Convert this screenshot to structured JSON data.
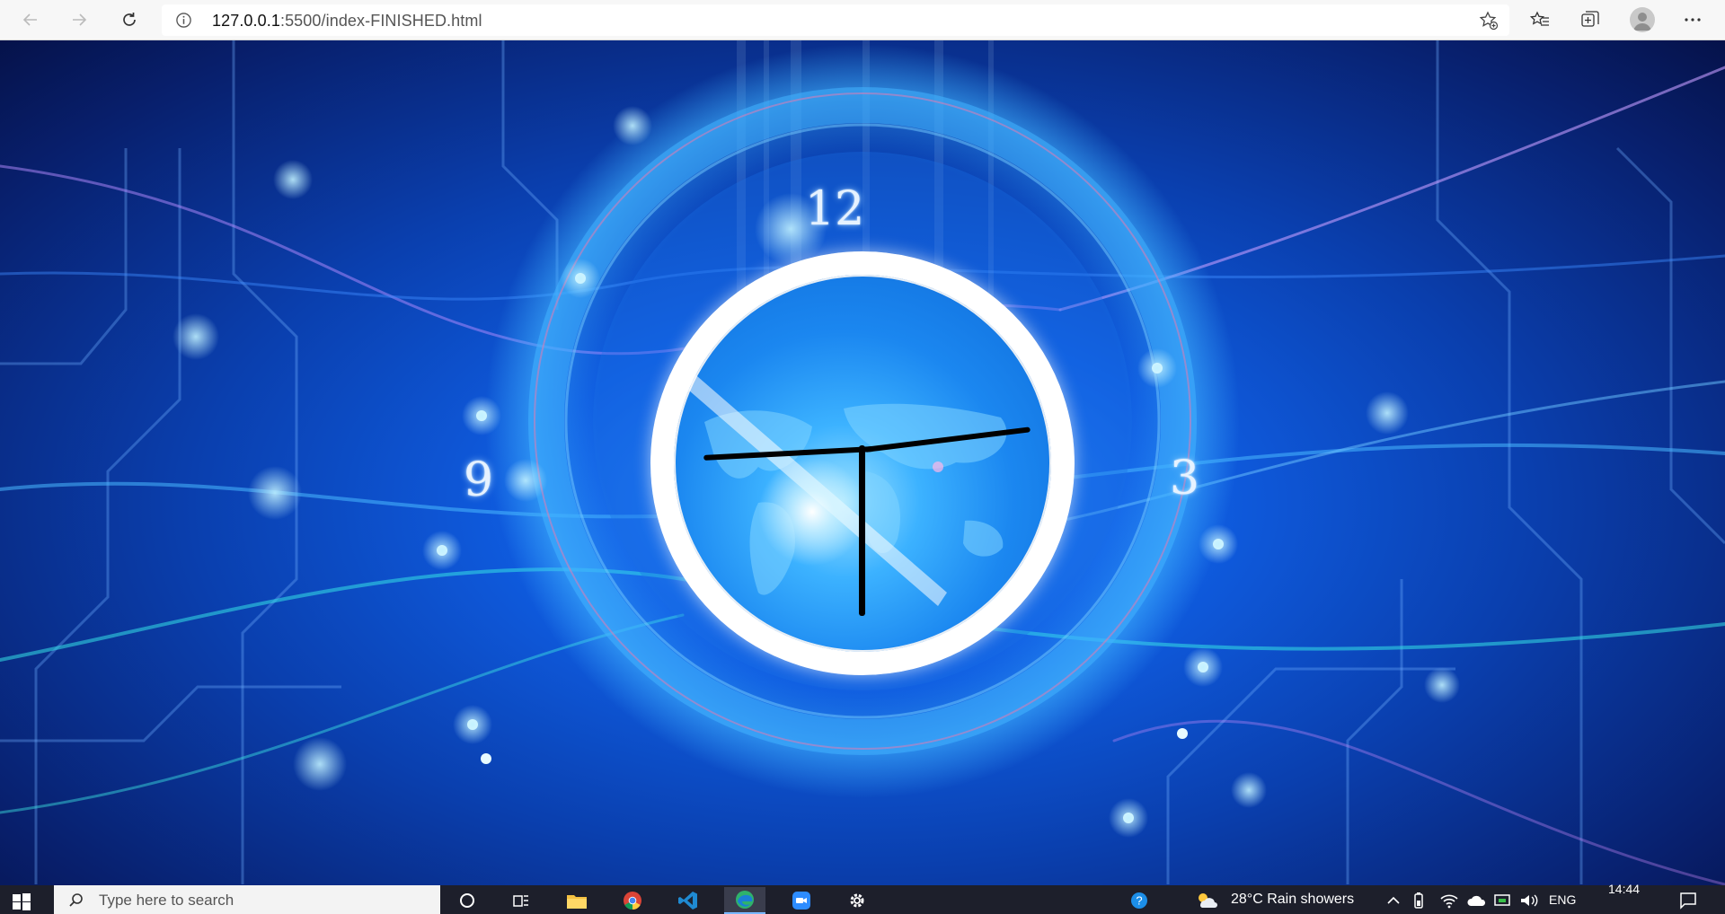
{
  "browser": {
    "url_host": "127.0.0.1",
    "url_path": ":5500/index-FINISHED.html"
  },
  "clock": {
    "numerals": {
      "twelve": "12",
      "three": "3",
      "nine": "9"
    }
  },
  "taskbar": {
    "search_placeholder": "Type here to search",
    "weather": "28°C  Rain showers",
    "language": "ENG",
    "time": "14:44"
  },
  "colors": {
    "accent_blue": "#1b87f0",
    "taskbar": "#1d1f2b",
    "chrome": "#f7f7f7"
  },
  "icons": [
    "back-icon",
    "forward-icon",
    "refresh-icon",
    "info-icon",
    "add-favorite-icon",
    "favorites-icon",
    "collections-icon",
    "profile-icon",
    "more-icon",
    "windows-start-icon",
    "search-icon",
    "cortana-icon",
    "task-view-icon",
    "file-explorer-icon",
    "chrome-icon",
    "vscode-icon",
    "edge-icon",
    "zoom-icon",
    "settings-icon",
    "help-icon",
    "weather-icon",
    "show-hidden-icon",
    "battery-icon",
    "wifi-icon",
    "onedrive-icon",
    "volume-icon",
    "notifications-icon"
  ]
}
